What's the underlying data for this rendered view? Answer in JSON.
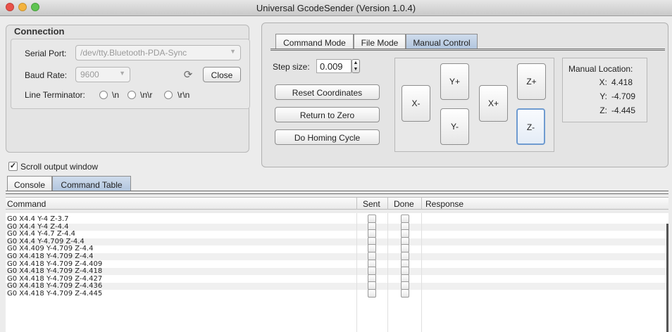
{
  "window": {
    "title": "Universal GcodeSender (Version 1.0.4)"
  },
  "connection": {
    "title": "Connection",
    "serial_port_label": "Serial Port:",
    "serial_port_value": "/dev/tty.Bluetooth-PDA-Sync",
    "baud_rate_label": "Baud Rate:",
    "baud_rate_value": "9600",
    "close_label": "Close",
    "line_terminator_label": "Line Terminator:",
    "terminators": [
      "\\n",
      "\\n\\r",
      "\\r\\n"
    ]
  },
  "scroll_output": {
    "label": "Scroll output window",
    "checked": true
  },
  "bottom_tabs": [
    "Console",
    "Command Table"
  ],
  "mode_tabs": [
    "Command Mode",
    "File Mode",
    "Manual Control"
  ],
  "manual": {
    "step_label": "Step size:",
    "step_value": "0.009",
    "buttons": [
      "Reset Coordinates",
      "Return to Zero",
      "Do Homing Cycle"
    ],
    "jog": {
      "xm": "X-",
      "yp": "Y+",
      "ym": "Y-",
      "xp": "X+",
      "zp": "Z+",
      "zm": "Z-"
    },
    "location": {
      "title": "Manual Location:",
      "x_label": "X:",
      "x": "4.418",
      "y_label": "Y:",
      "y": "-4.709",
      "z_label": "Z:",
      "z": "-4.445"
    }
  },
  "table": {
    "headers": [
      "Command",
      "Sent",
      "Done",
      "Response"
    ],
    "rows": [
      "G0 X4.4 Y-4 Z-3.7",
      "G0 X4.4 Y-4 Z-4.4",
      "G0 X4.4 Y-4.7 Z-4.4",
      "G0 X4.4 Y-4.709 Z-4.4",
      "G0 X4.409 Y-4.709 Z-4.4",
      "G0 X4.418 Y-4.709 Z-4.4",
      "G0 X4.418 Y-4.709 Z-4.409",
      "G0 X4.418 Y-4.709 Z-4.418",
      "G0 X4.418 Y-4.709 Z-4.427",
      "G0 X4.418 Y-4.709 Z-4.436",
      "G0 X4.418 Y-4.709 Z-4.445"
    ]
  }
}
